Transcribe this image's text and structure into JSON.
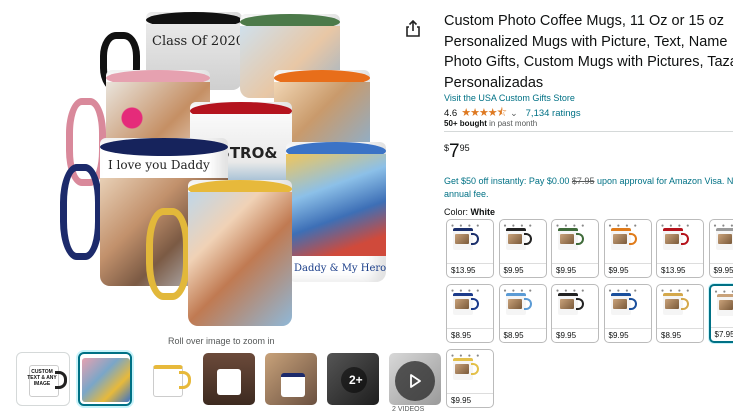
{
  "product": {
    "title_lines": [
      "Custom Photo Coffee Mugs, 11 Oz or 15 oz",
      "Personalized Mugs with Picture, Text, Name",
      "Photo Gifts, Custom Mugs with Pictures, Tazas",
      "Personalizadas"
    ],
    "store_link": "Visit the USA Custom Gifts Store",
    "rating_value": "4.6",
    "stars": "★★★★⯪",
    "ratings_count": "7,134 ratings",
    "bought_bold": "50+ bought",
    "bought_rest": " in past month",
    "price": {
      "symbol": "$",
      "whole": "7",
      "fraction": "95"
    },
    "promo": {
      "part1": "Get $50 off instantly: Pay $0.00 ",
      "strike": "$7.95",
      "part2": " upon approval for Amazon Visa. No",
      "line2": "annual fee."
    },
    "color_label": "Color: ",
    "color_value": "White"
  },
  "gallery": {
    "roll_over_text": "Roll over image to zoom in",
    "more_thumbs_label": "2+",
    "videos_label": "2 VIDEOS",
    "mug_texts": {
      "class_of": "Class Of 2020",
      "bistro": "BISTRO&",
      "love_daddy": "I love you Daddy",
      "daddy_hero": "Daddy & My Hero",
      "thumb_text": "CUSTOM TEXT & ANY IMAGE"
    }
  },
  "swatches": [
    {
      "price": "$13.95",
      "mug_color": "#1b2f6b"
    },
    {
      "price": "$9.95",
      "mug_color": "#222222"
    },
    {
      "price": "$9.95",
      "mug_color": "#3f6b3a"
    },
    {
      "price": "$9.95",
      "mug_color": "#e07b1a"
    },
    {
      "price": "$13.95",
      "mug_color": "#b5121b"
    },
    {
      "price": "$9.95",
      "mug_color": "#9a9a9a"
    },
    {
      "price": "$8.95",
      "mug_color": "#1b3a8a"
    },
    {
      "price": "$8.95",
      "mug_color": "#5b9bd5"
    },
    {
      "price": "$9.95",
      "mug_color": "#222222"
    },
    {
      "price": "$9.95",
      "mug_color": "#1a4f9c"
    },
    {
      "price": "$8.95",
      "mug_color": "#d4a84b"
    },
    {
      "price": "$7.95",
      "mug_color": "#c9a27a"
    },
    {
      "price": "$9.95",
      "mug_color": "#e3c04a"
    }
  ],
  "colors": {
    "link": "#007185",
    "star": "#de7921",
    "selected_border": "#007185"
  }
}
